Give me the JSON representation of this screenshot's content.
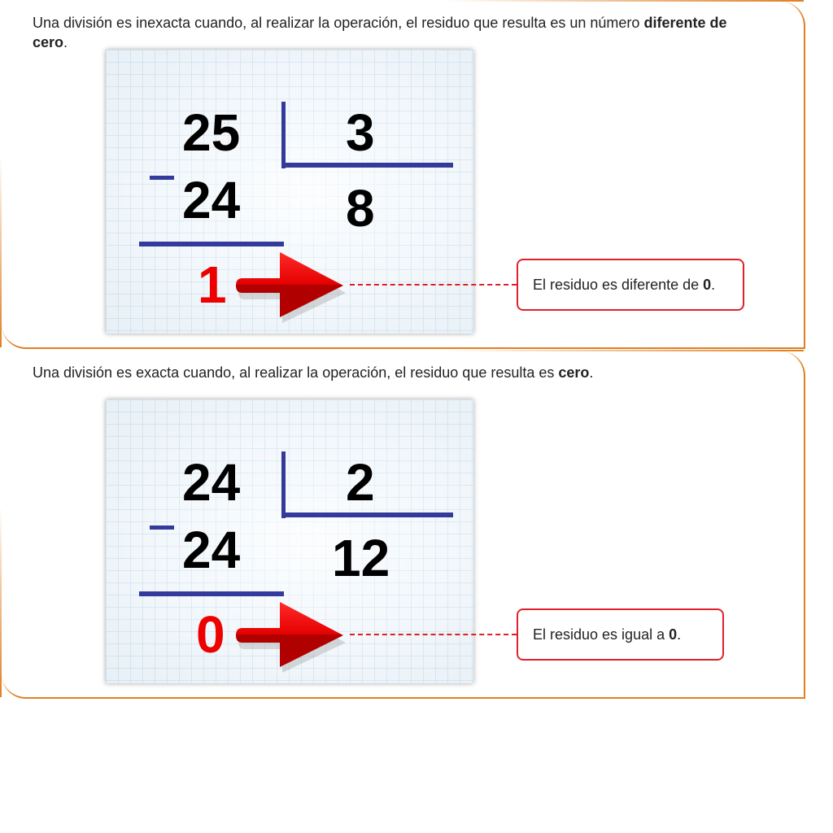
{
  "inexact": {
    "intro_text": "Una división es inexacta cuando, al realizar la operación, el residuo que resulta es un número ",
    "intro_bold": "diferente de cero",
    "intro_end": ".",
    "dividend": "25",
    "divisor": "3",
    "product": "24",
    "quotient": "8",
    "remainder": "1",
    "callout_text": "El residuo es diferente de ",
    "callout_bold": "0",
    "callout_end": "."
  },
  "exact": {
    "intro_text": "Una división es exacta cuando, al realizar la operación, el residuo que resulta es ",
    "intro_bold": "cero",
    "intro_end": ".",
    "dividend": "24",
    "divisor": "2",
    "product": "24",
    "quotient": "12",
    "remainder": "0",
    "callout_text": "El residuo es igual a ",
    "callout_bold": "0",
    "callout_end": "."
  },
  "colors": {
    "panel_border": "#e07f22",
    "division_lines": "#333a9b",
    "remainder": "#ee0000",
    "arrow": "#e00000",
    "callout_border": "#e0202a"
  }
}
